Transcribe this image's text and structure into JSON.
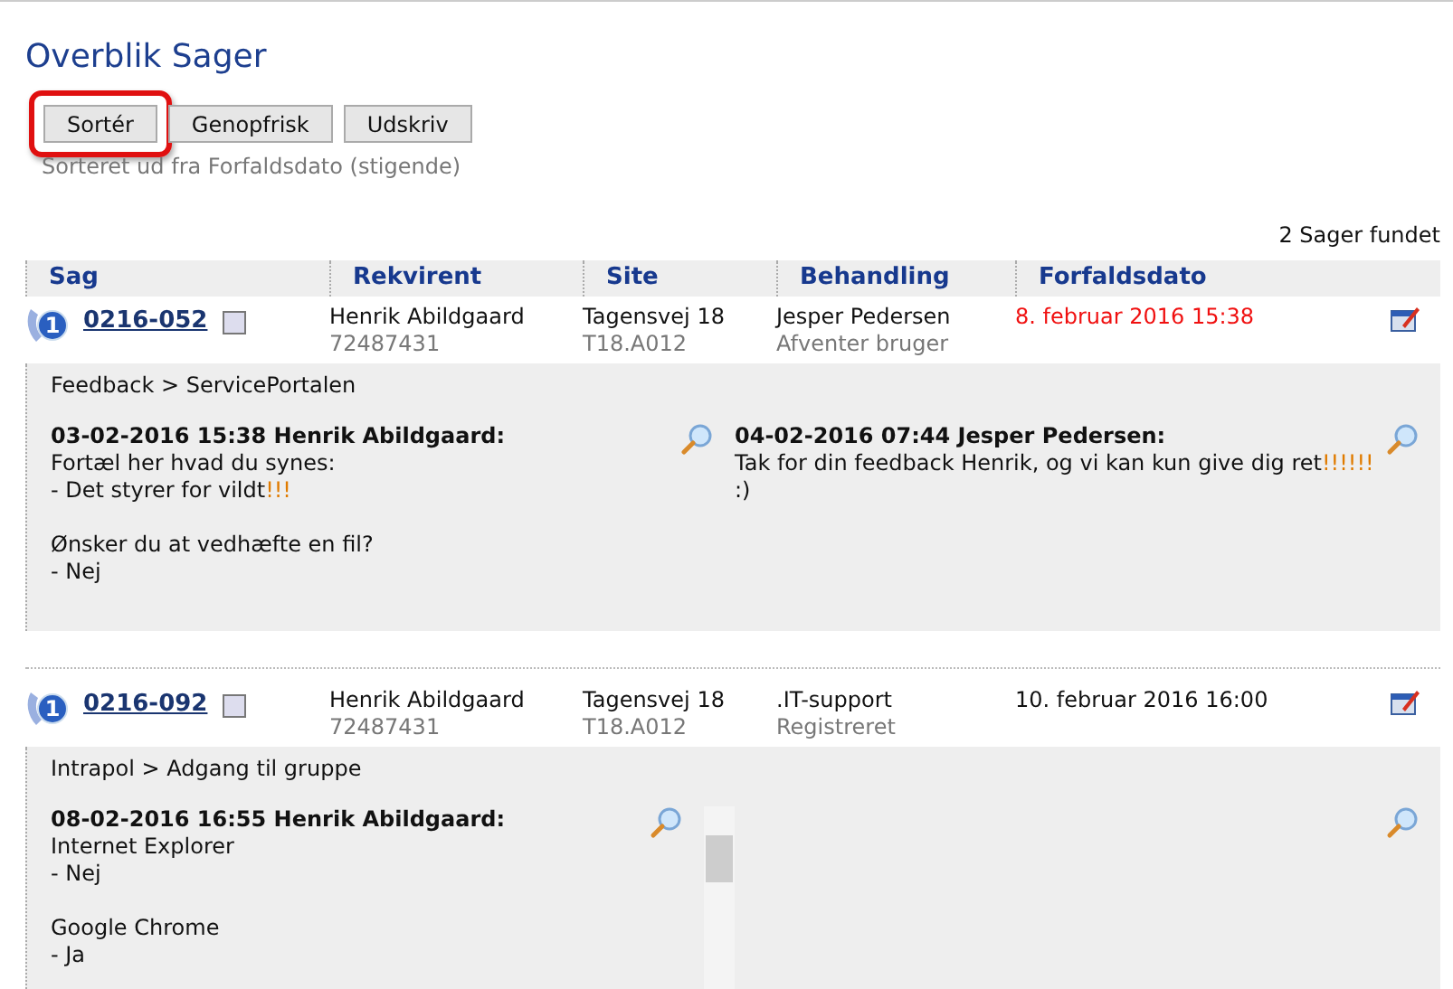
{
  "title": "Overblik Sager",
  "buttons": [
    {
      "label": "Sortér",
      "highlighted": true
    },
    {
      "label": "Genopfrisk",
      "highlighted": false
    },
    {
      "label": "Udskriv",
      "highlighted": false
    }
  ],
  "sort_note": "Sorteret ud fra Forfaldsdato (stigende)",
  "result_count": "2 Sager fundet",
  "columns": [
    "Sag",
    "Rekvirent",
    "Site",
    "Behandling",
    "Forfaldsdato"
  ],
  "cases": [
    {
      "priority": "1",
      "number": "0216-052",
      "checked": false,
      "requester": "Henrik Abildgaard",
      "phone": "72487431",
      "site": "Tagensvej 18",
      "room": "T18.A012",
      "handler": "Jesper Pedersen",
      "status": "Afventer bruger",
      "due": "8. februar 2016 15:38",
      "overdue": true,
      "category": "Feedback > ServicePortalen",
      "scroll": false,
      "messages": [
        {
          "kind": "text",
          "header": "03-02-2016 15:38 Henrik Abildgaard:",
          "lines": [
            {
              "kind": "text",
              "segments": [
                {
                  "text": "Fortæl her hvad du synes:",
                  "highlight": false
                }
              ]
            },
            {
              "kind": "text",
              "segments": [
                {
                  "text": "- Det styrer for vildt",
                  "highlight": false
                },
                {
                  "text": "!!!",
                  "highlight": true
                }
              ]
            },
            {
              "kind": "blank"
            },
            {
              "kind": "text",
              "segments": [
                {
                  "text": "Ønsker du at vedhæfte en fil?",
                  "highlight": false
                }
              ]
            },
            {
              "kind": "text",
              "segments": [
                {
                  "text": "- Nej",
                  "highlight": false
                }
              ]
            }
          ]
        },
        {
          "kind": "text",
          "header": "04-02-2016 07:44 Jesper Pedersen:",
          "lines": [
            {
              "kind": "text",
              "segments": [
                {
                  "text": "Tak for din feedback Henrik, og vi kan kun give dig ret",
                  "highlight": false
                },
                {
                  "text": "!!!!!!",
                  "highlight": true
                }
              ]
            },
            {
              "kind": "text",
              "segments": [
                {
                  "text": ":)",
                  "highlight": false
                }
              ]
            }
          ]
        }
      ]
    },
    {
      "priority": "1",
      "number": "0216-092",
      "checked": false,
      "requester": "Henrik Abildgaard",
      "phone": "72487431",
      "site": "Tagensvej 18",
      "room": "T18.A012",
      "handler": ".IT-support",
      "status": "Registreret",
      "due": "10. februar 2016 16:00",
      "overdue": false,
      "category": "Intrapol > Adgang til gruppe",
      "scroll": true,
      "messages": [
        {
          "kind": "text",
          "header": "08-02-2016 16:55 Henrik Abildgaard:",
          "lines": [
            {
              "kind": "text",
              "segments": [
                {
                  "text": "Internet Explorer",
                  "highlight": false
                }
              ]
            },
            {
              "kind": "text",
              "segments": [
                {
                  "text": "- Nej",
                  "highlight": false
                }
              ]
            },
            {
              "kind": "blank"
            },
            {
              "kind": "text",
              "segments": [
                {
                  "text": "Google Chrome",
                  "highlight": false
                }
              ]
            },
            {
              "kind": "text",
              "segments": [
                {
                  "text": "- Ja",
                  "highlight": false
                }
              ]
            }
          ]
        },
        {
          "kind": "empty"
        }
      ]
    }
  ]
}
